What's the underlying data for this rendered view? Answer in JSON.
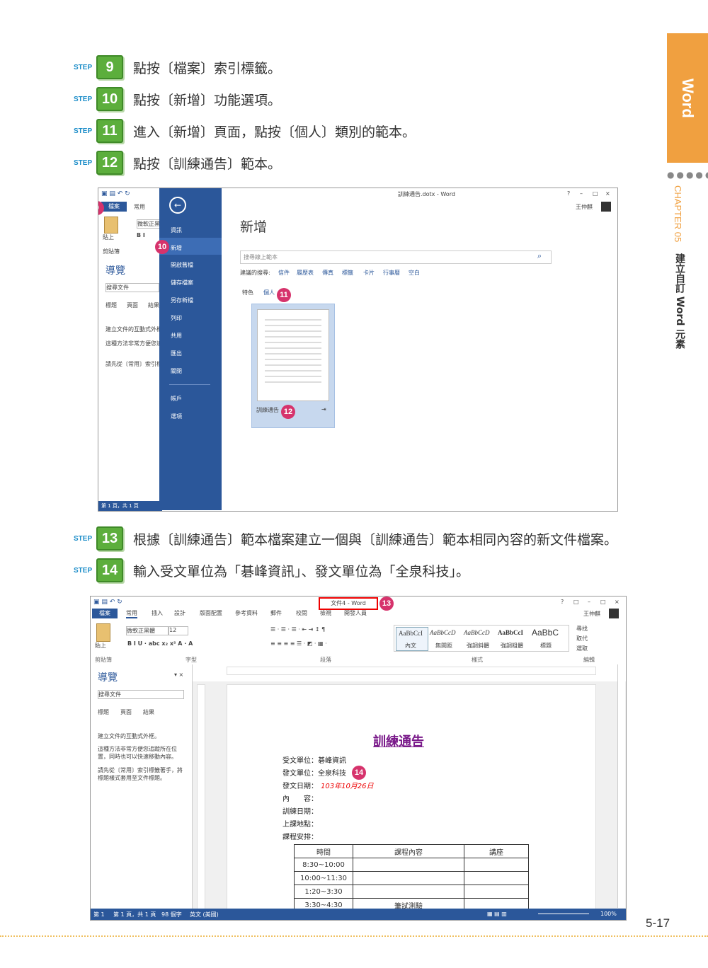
{
  "side_tab": {
    "label": "Word",
    "chapter": "CHAPTER 05",
    "chapter_title": "建立自訂 Word 元素",
    "dots": "●●●●●"
  },
  "steps_top": [
    {
      "word": "STEP",
      "num": "9",
      "text": "點按〔檔案〕索引標籤。"
    },
    {
      "word": "STEP",
      "num": "10",
      "text": "點按〔新增〕功能選項。"
    },
    {
      "word": "STEP",
      "num": "11",
      "text": "進入〔新增〕頁面，點按〔個人〕類別的範本。"
    },
    {
      "word": "STEP",
      "num": "12",
      "text": "點按〔訓練通告〕範本。"
    }
  ],
  "steps_bottom": [
    {
      "word": "STEP",
      "num": "13",
      "text": "根據〔訓練通告〕範本檔案建立一個與〔訓練通告〕範本相同內容的新文件檔案。"
    },
    {
      "word": "STEP",
      "num": "14",
      "text": "輸入受文單位為「碁峰資訊」、發文單位為「全泉科技」。"
    }
  ],
  "shot1": {
    "title": "訓練通告.dotx - Word",
    "user": "王仲麒",
    "window_controls": [
      "?",
      "–",
      "□",
      "×"
    ],
    "tabs": [
      "檔案",
      "常用"
    ],
    "font_box": "微軟正黑體",
    "paste_label": "貼上",
    "clipboard_label": "剪貼簿",
    "nav_title": "導覽",
    "nav_search": "搜尋文件",
    "nav_tabs": [
      "標題",
      "頁面",
      "結果"
    ],
    "nav_text": [
      "建立文件的互動式外框。",
      "這種方法非常方便您追蹤所在位置，同時也可以快速移動內容。",
      "請先從〔常用〕索引標籤著手，將標題樣式套用至文件標題。"
    ],
    "backstage_menu": [
      "資訊",
      "新增",
      "開啟舊檔",
      "儲存檔案",
      "另存新檔",
      "列印",
      "共用",
      "匯出",
      "關閉",
      "帳戶",
      "選項"
    ],
    "new_heading": "新增",
    "search_placeholder": "搜尋線上範本",
    "suggested_label": "建議的搜尋:",
    "suggested": [
      "信件",
      "履歷表",
      "傳真",
      "標籤",
      "卡片",
      "行事曆",
      "空白"
    ],
    "categories": [
      "特色",
      "個人"
    ],
    "template_name": "訓練通告",
    "status": "第 1 頁，共 1 頁",
    "callouts": [
      "9",
      "10",
      "11",
      "12"
    ]
  },
  "shot2": {
    "title": "文件4 - Word",
    "user": "王仲麒",
    "window_controls": [
      "?",
      "□",
      "–",
      "□",
      "×"
    ],
    "tabs": [
      "檔案",
      "常用",
      "插入",
      "設計",
      "版面配置",
      "參考資料",
      "郵件",
      "校閱",
      "檢視",
      "開發人員"
    ],
    "font": "微軟正黑體",
    "font_size": "12",
    "styles": [
      {
        "sample": "AaBbCcI",
        "name": "內文"
      },
      {
        "sample": "AaBbCcD",
        "name": "無間距"
      },
      {
        "sample": "AaBbCcD",
        "name": "強調斜體"
      },
      {
        "sample": "AaBbCcI",
        "name": "強調粗體"
      },
      {
        "sample": "AaBbC",
        "name": "標題"
      }
    ],
    "editing": [
      "尋找",
      "取代",
      "選取"
    ],
    "group_labels": [
      "剪貼簿",
      "字型",
      "段落",
      "樣式",
      "編輯"
    ],
    "paste_label": "貼上",
    "nav_title": "導覽",
    "nav_search": "搜尋文件",
    "nav_tabs": [
      "標題",
      "頁面",
      "結果"
    ],
    "nav_text": [
      "建立文件的互動式外框。",
      "這種方法非常方便您追蹤所在位置，同時也可以快速移動內容。",
      "請先從〔常用〕索引標籤著手，將標題樣式套用至文件標題。"
    ],
    "doc": {
      "heading": "訓練通告",
      "lines": [
        "受文單位：碁峰資訊",
        "發文單位：全泉科技",
        "發文日期：",
        "內　　容：",
        "訓練日期：",
        "上課地點：",
        "課程安排："
      ],
      "date_value": "103年10月26日",
      "table_headers": [
        "時間",
        "課程內容",
        "講座"
      ],
      "table_rows": [
        [
          "8:30~10:00",
          "",
          ""
        ],
        [
          "10:00~11:30",
          "",
          ""
        ],
        [
          "1:20~3:30",
          "",
          ""
        ],
        [
          "3:30~4:30",
          "筆試測驗",
          ""
        ]
      ]
    },
    "status": [
      "第 1",
      "第 1 頁，共 1 頁",
      "98 個字",
      "英文 (美國)"
    ],
    "zoom": "100%",
    "callouts": [
      "13",
      "14"
    ]
  },
  "page_number": "5-17"
}
